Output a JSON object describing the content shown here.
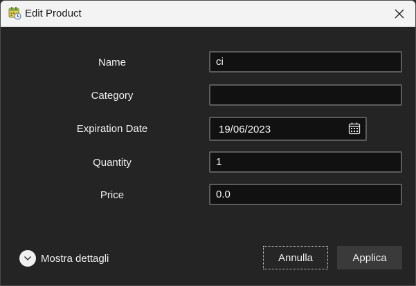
{
  "window": {
    "title": "Edit Product",
    "app_icon": "calendar-clock-icon",
    "close_icon": "close-icon"
  },
  "form": {
    "name": {
      "label": "Name",
      "value": "ci"
    },
    "category": {
      "label": "Category",
      "value": ""
    },
    "expiration": {
      "label": "Expiration Date",
      "value": "19/06/2023",
      "icon": "calendar-icon"
    },
    "quantity": {
      "label": "Quantity",
      "value": "1"
    },
    "price": {
      "label": "Price",
      "value": "0.0"
    }
  },
  "footer": {
    "details_label": "Mostra dettagli",
    "details_icon": "chevron-down-icon",
    "cancel_label": "Annulla",
    "apply_label": "Applica"
  },
  "colors": {
    "background": "#242424",
    "titlebar": "#f3f3f3",
    "field_background": "#111111",
    "field_border": "#5b5b5b",
    "text": "#f0f0f0",
    "apply_button": "#3a3a3a"
  }
}
